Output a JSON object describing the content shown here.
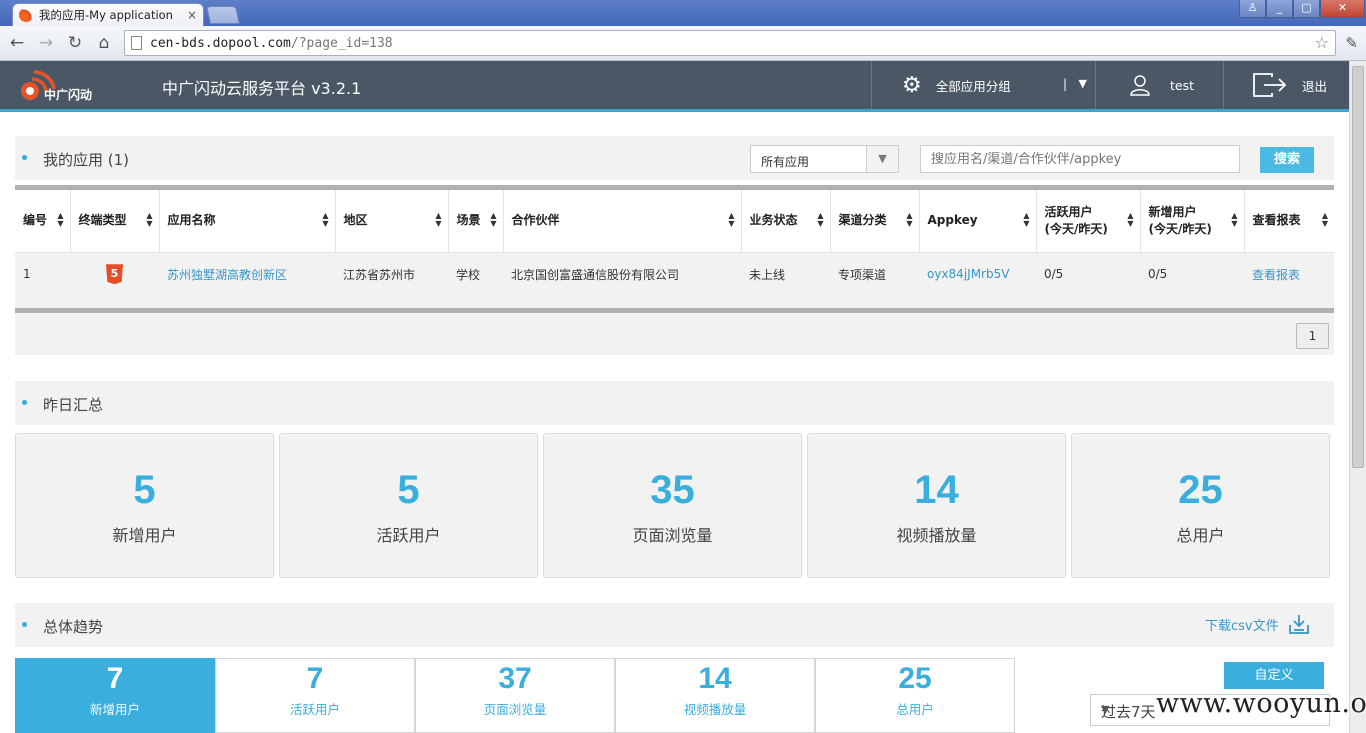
{
  "browser": {
    "tab_title": "我的应用-My application",
    "tab_close": "×",
    "url_host": "cen-bds.dopool.com",
    "url_path": "/?page_id=138",
    "back": "←",
    "forward": "→",
    "reload": "↻",
    "home": "⌂",
    "win_min": "_",
    "win_max": "▢",
    "win_close": "✕",
    "win_user": "♙"
  },
  "header": {
    "logo_text": "中广闪动",
    "platform_title": "中广闪动云服务平台 v3.2.1",
    "groups_label": "全部应用分组",
    "groups_bar": "|",
    "groups_caret": "▼",
    "user_name": "test",
    "logout_label": "退出"
  },
  "my_apps": {
    "title": "我的应用 (1)",
    "filter_value": "所有应用",
    "filter_arrow": "▼",
    "search_placeholder": "搜应用名/渠道/合作伙伴/appkey",
    "search_button": "搜索",
    "columns": [
      "编号",
      "终端类型",
      "应用名称",
      "地区",
      "场景",
      "合作伙伴",
      "业务状态",
      "渠道分类",
      "Appkey",
      "活跃用户\n(今天/昨天)",
      "新增用户\n(今天/昨天)",
      "查看报表"
    ],
    "sort_glyph": "▲▼",
    "rows": [
      {
        "id": "1",
        "terminal": "5",
        "app_name": "苏州独墅湖高教创新区",
        "region": "江苏省苏州市",
        "scene": "学校",
        "partner": "北京国创富盛通信股份有限公司",
        "status": "未上线",
        "channel": "专项渠道",
        "appkey": "oyx84jJMrb5V",
        "active": "0/5",
        "new_users": "0/5",
        "report": "查看报表"
      }
    ],
    "page": "1"
  },
  "yesterday": {
    "title": "昨日汇总",
    "cards": [
      {
        "value": "5",
        "label": "新增用户"
      },
      {
        "value": "5",
        "label": "活跃用户"
      },
      {
        "value": "35",
        "label": "页面浏览量"
      },
      {
        "value": "14",
        "label": "视频播放量"
      },
      {
        "value": "25",
        "label": "总用户"
      }
    ]
  },
  "trend": {
    "title": "总体趋势",
    "download": "下载csv文件",
    "tabs": [
      {
        "value": "7",
        "label": "新增用户"
      },
      {
        "value": "7",
        "label": "活跃用户"
      },
      {
        "value": "37",
        "label": "页面浏览量"
      },
      {
        "value": "14",
        "label": "视频播放量"
      },
      {
        "value": "25",
        "label": "总用户"
      }
    ],
    "custom_button": "自定义",
    "range_value": "过去7天",
    "range_arrow": "▼"
  },
  "watermark": "www.wooyun.org",
  "colors": {
    "accent": "#3aaedc",
    "header_bg": "#4a5866",
    "html5": "#e44d26"
  }
}
